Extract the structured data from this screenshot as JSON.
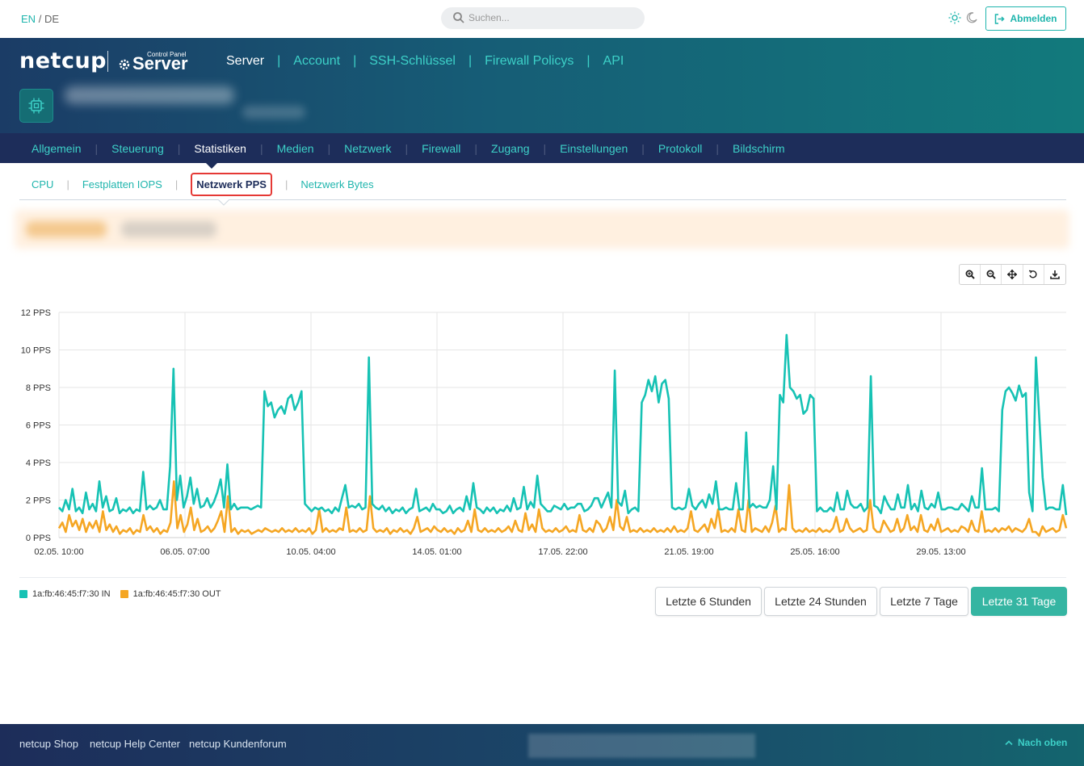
{
  "lang": {
    "en": "EN",
    "sep": "/",
    "de": "DE"
  },
  "search": {
    "placeholder": "Suchen..."
  },
  "logout": {
    "label": "Abmelden"
  },
  "brand": {
    "logo": "netcup",
    "cp_small": "Control Panel",
    "cp_big": "Server"
  },
  "main_nav": [
    {
      "label": "Server",
      "active": true
    },
    {
      "label": "Account"
    },
    {
      "label": "SSH-Schlüssel"
    },
    {
      "label": "Firewall Policys"
    },
    {
      "label": "API"
    }
  ],
  "tabs": [
    {
      "label": "Allgemein"
    },
    {
      "label": "Steuerung"
    },
    {
      "label": "Statistiken",
      "active": true
    },
    {
      "label": "Medien"
    },
    {
      "label": "Netzwerk"
    },
    {
      "label": "Firewall"
    },
    {
      "label": "Zugang"
    },
    {
      "label": "Einstellungen"
    },
    {
      "label": "Protokoll"
    },
    {
      "label": "Bildschirm"
    }
  ],
  "subtabs": [
    {
      "label": "CPU"
    },
    {
      "label": "Festplatten IOPS"
    },
    {
      "label": "Netzwerk PPS",
      "active": true
    },
    {
      "label": "Netzwerk Bytes"
    }
  ],
  "toolbar": [
    "zoom-in-icon",
    "zoom-out-icon",
    "pan-icon",
    "reset-icon",
    "download-icon"
  ],
  "chart_data": {
    "type": "line",
    "title": "",
    "y_ticks": [
      "12 PPS",
      "10 PPS",
      "8 PPS",
      "6 PPS",
      "4 PPS",
      "2 PPS",
      "0 PPS"
    ],
    "ylim": [
      0,
      12
    ],
    "x_ticks": [
      "02.05. 10:00",
      "06.05. 07:00",
      "10.05. 04:00",
      "14.05. 01:00",
      "17.05. 22:00",
      "21.05. 19:00",
      "25.05. 16:00",
      "29.05. 13:00"
    ],
    "series": [
      {
        "name": "1a:fb:46:45:f7:30 IN",
        "color": "#16c2b4",
        "values": [
          1.6,
          1.4,
          2.0,
          1.5,
          2.6,
          1.4,
          1.6,
          1.3,
          2.4,
          1.5,
          1.8,
          1.4,
          3.0,
          1.6,
          2.2,
          1.4,
          1.5,
          2.1,
          1.3,
          1.5,
          1.4,
          1.6,
          1.3,
          1.5,
          1.4,
          3.5,
          1.5,
          1.7,
          1.5,
          1.6,
          2.0,
          1.5,
          1.5,
          3.8,
          9.0,
          2.0,
          3.3,
          1.6,
          2.2,
          3.2,
          1.8,
          2.6,
          1.6,
          1.7,
          2.1,
          1.6,
          1.9,
          2.4,
          3.1,
          1.6,
          3.9,
          1.5,
          1.8,
          1.5,
          1.6,
          1.6,
          1.6,
          1.5,
          1.6,
          1.7,
          1.6,
          7.8,
          7.0,
          7.2,
          6.4,
          6.8,
          7.0,
          6.6,
          7.4,
          7.6,
          6.8,
          7.2,
          7.8,
          1.8,
          1.6,
          1.4,
          1.6,
          1.5,
          1.6,
          1.4,
          1.5,
          1.3,
          1.6,
          1.4,
          2.1,
          2.8,
          1.6,
          1.7,
          1.6,
          1.8,
          1.5,
          1.6,
          9.6,
          1.8,
          1.6,
          1.5,
          1.7,
          1.4,
          1.6,
          1.3,
          1.5,
          1.4,
          1.6,
          1.3,
          1.5,
          1.6,
          2.6,
          1.4,
          1.5,
          1.6,
          1.4,
          1.8,
          1.5,
          1.5,
          1.3,
          1.4,
          1.7,
          1.3,
          1.5,
          1.6,
          1.4,
          2.2,
          1.5,
          2.9,
          1.6,
          1.5,
          1.3,
          1.6,
          1.4,
          1.6,
          1.3,
          1.5,
          1.4,
          1.7,
          1.4,
          2.1,
          1.5,
          1.6,
          2.7,
          1.5,
          1.9,
          1.6,
          3.3,
          1.8,
          1.6,
          1.4,
          1.4,
          1.7,
          1.6,
          1.5,
          1.8,
          1.5,
          1.6,
          1.6,
          1.8,
          1.8,
          1.4,
          1.5,
          1.7,
          2.1,
          2.1,
          1.6,
          2.0,
          2.4,
          1.6,
          8.9,
          1.9,
          1.7,
          2.5,
          1.3,
          1.5,
          1.6,
          1.4,
          7.2,
          7.6,
          8.4,
          7.8,
          8.6,
          7.2,
          8.2,
          8.4,
          7.4,
          1.6,
          1.5,
          1.6,
          1.5,
          1.6,
          2.6,
          1.7,
          1.5,
          1.8,
          2.0,
          1.6,
          2.3,
          1.8,
          3.0,
          1.5,
          1.5,
          1.6,
          1.5,
          1.5,
          2.9,
          1.5,
          1.5,
          5.6,
          1.6,
          1.8,
          1.6,
          1.7,
          1.6,
          1.6,
          2.0,
          3.8,
          1.5,
          7.6,
          7.2,
          10.8,
          8.0,
          7.8,
          7.4,
          7.6,
          6.6,
          6.8,
          7.6,
          7.4,
          1.4,
          1.6,
          1.4,
          1.4,
          1.6,
          1.4,
          2.4,
          1.5,
          1.5,
          2.5,
          1.8,
          1.6,
          1.6,
          1.8,
          1.4,
          1.6,
          8.6,
          1.7,
          1.6,
          1.3,
          2.2,
          1.8,
          1.5,
          1.5,
          2.3,
          1.6,
          1.6,
          2.8,
          1.5,
          1.8,
          1.4,
          2.5,
          1.6,
          1.5,
          1.8,
          1.6,
          2.4,
          1.5,
          1.5,
          1.6,
          1.6,
          1.5,
          1.5,
          1.8,
          1.6,
          1.4,
          2.2,
          1.6,
          1.6,
          3.7,
          1.5,
          1.5,
          1.5,
          1.6,
          1.4,
          6.8,
          7.8,
          8.0,
          7.7,
          7.3,
          8.1,
          7.5,
          7.7,
          2.4,
          1.4,
          9.6,
          6.4,
          3.2,
          1.5,
          1.6,
          1.6,
          1.5,
          1.5,
          2.8,
          1.2
        ]
      },
      {
        "name": "1a:fb:46:45:f7:30 OUT",
        "color": "#f5a623",
        "values": [
          0.5,
          0.8,
          0.3,
          1.2,
          0.6,
          0.9,
          0.4,
          1.0,
          0.3,
          0.8,
          0.5,
          0.9,
          0.3,
          1.4,
          0.4,
          0.7,
          0.3,
          0.6,
          0.2,
          0.4,
          0.3,
          0.5,
          0.2,
          0.4,
          0.3,
          1.2,
          0.4,
          0.6,
          0.3,
          0.5,
          0.2,
          0.4,
          0.3,
          0.8,
          3.0,
          0.5,
          1.2,
          0.3,
          0.7,
          1.6,
          0.4,
          1.0,
          0.3,
          0.4,
          0.6,
          0.3,
          0.5,
          0.9,
          1.4,
          0.3,
          2.2,
          0.3,
          0.5,
          0.2,
          0.4,
          0.3,
          0.4,
          0.2,
          0.3,
          0.4,
          0.3,
          0.5,
          0.4,
          0.3,
          0.4,
          0.3,
          0.5,
          0.3,
          0.4,
          0.3,
          0.5,
          0.3,
          0.4,
          0.3,
          0.5,
          0.2,
          0.4,
          1.5,
          0.3,
          0.5,
          0.3,
          0.4,
          0.3,
          0.5,
          0.4,
          1.6,
          0.3,
          0.4,
          0.3,
          0.5,
          0.3,
          0.4,
          2.2,
          0.5,
          0.3,
          0.4,
          0.3,
          0.5,
          0.2,
          0.4,
          0.3,
          0.5,
          0.3,
          0.4,
          0.2,
          0.5,
          1.1,
          0.3,
          0.4,
          0.5,
          0.3,
          0.6,
          0.4,
          0.3,
          0.5,
          0.3,
          0.4,
          0.2,
          0.5,
          0.3,
          0.4,
          0.9,
          0.3,
          1.5,
          0.4,
          0.3,
          0.5,
          0.3,
          0.4,
          0.3,
          0.5,
          0.3,
          0.4,
          0.6,
          0.3,
          0.9,
          0.4,
          0.3,
          1.3,
          0.4,
          0.7,
          0.3,
          1.5,
          0.5,
          0.3,
          0.4,
          0.3,
          0.5,
          0.3,
          0.4,
          0.6,
          0.3,
          0.4,
          0.3,
          1.2,
          0.4,
          0.3,
          0.5,
          0.3,
          0.9,
          0.7,
          0.3,
          0.5,
          1.1,
          0.4,
          2.0,
          0.6,
          0.4,
          1.1,
          0.3,
          0.4,
          0.3,
          0.5,
          0.3,
          0.4,
          0.3,
          0.5,
          0.3,
          0.4,
          0.3,
          0.5,
          0.3,
          0.6,
          0.3,
          0.4,
          0.3,
          0.5,
          1.4,
          0.4,
          0.3,
          0.5,
          0.7,
          0.3,
          1.0,
          0.5,
          1.5,
          0.3,
          0.4,
          0.3,
          0.5,
          0.3,
          1.5,
          0.4,
          0.3,
          2.0,
          0.3,
          0.5,
          0.4,
          0.3,
          0.6,
          0.3,
          0.8,
          1.7,
          0.3,
          0.5,
          0.4,
          2.8,
          0.5,
          0.3,
          0.4,
          0.3,
          0.5,
          0.3,
          0.4,
          0.3,
          0.5,
          0.3,
          0.4,
          0.3,
          0.5,
          1.1,
          0.3,
          0.4,
          1.0,
          0.5,
          0.3,
          0.4,
          0.5,
          0.3,
          0.4,
          2.0,
          0.5,
          0.3,
          0.3,
          0.9,
          0.6,
          0.3,
          0.4,
          1.0,
          0.3,
          0.5,
          1.2,
          0.4,
          0.6,
          0.3,
          1.2,
          0.4,
          0.3,
          0.7,
          0.4,
          1.0,
          0.3,
          0.4,
          0.5,
          0.3,
          0.4,
          0.3,
          0.6,
          0.5,
          0.3,
          0.9,
          0.4,
          0.3,
          1.4,
          0.3,
          0.4,
          0.3,
          0.5,
          0.3,
          0.5,
          0.4,
          0.6,
          0.3,
          0.5,
          0.4,
          0.3,
          0.5,
          1.0,
          0.3,
          0.3,
          0.1,
          0.6,
          0.3,
          0.4,
          0.5,
          0.3,
          0.4,
          1.2,
          0.5
        ]
      }
    ],
    "grid": true,
    "legend": "bottom-left"
  },
  "ranges": [
    {
      "label": "Letzte 6 Stunden"
    },
    {
      "label": "Letzte 24 Stunden"
    },
    {
      "label": "Letzte 7 Tage"
    },
    {
      "label": "Letzte 31 Tage",
      "active": true
    }
  ],
  "footer": {
    "links": [
      "netcup Shop",
      "netcup Help Center",
      "netcup Kundenforum"
    ],
    "back_to_top": "Nach oben"
  }
}
